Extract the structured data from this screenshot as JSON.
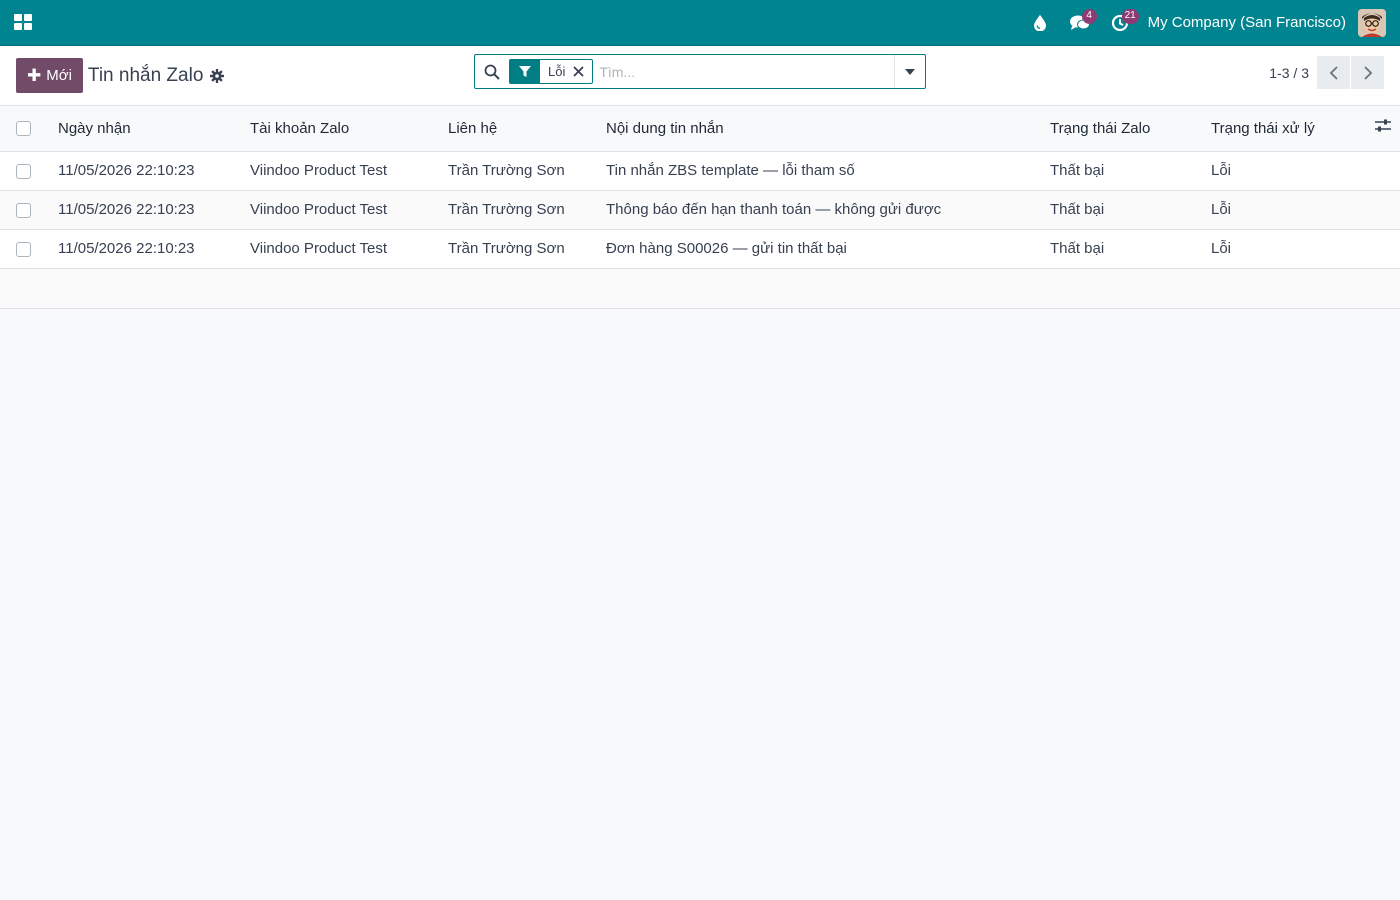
{
  "navbar": {
    "apps_icon": "apps-grid-icon",
    "icons": [
      {
        "name": "drop-icon",
        "badge": ""
      },
      {
        "name": "chat-icon",
        "badge": "4"
      },
      {
        "name": "activity-clock-icon",
        "badge": "21"
      }
    ],
    "company": "My Company (San Francisco)",
    "accent": "#00848f"
  },
  "control": {
    "new_label": "Mới",
    "title": "Tin nhắn Zalo",
    "search": {
      "facet_value": "Lỗi",
      "placeholder": "Tìm..."
    },
    "pager": "1-3 / 3"
  },
  "table": {
    "headers": [
      "Ngày nhận",
      "Tài khoản Zalo",
      "Liên hệ",
      "Nội dung tin nhắn",
      "Trạng thái Zalo",
      "Trạng thái xử lý"
    ],
    "rows": [
      [
        "11/05/2026 22:10:23",
        "Viindoo Product Test",
        "Trần Trường Sơn",
        "Tin nhắn ZBS template — lỗi tham số",
        "Thất bại",
        "Lỗi"
      ],
      [
        "11/05/2026 22:10:23",
        "Viindoo Product Test",
        "Trần Trường Sơn",
        "Thông báo đến hạn thanh toán — không gửi được",
        "Thất bại",
        "Lỗi"
      ],
      [
        "11/05/2026 22:10:23",
        "Viindoo Product Test",
        "Trần Trường Sơn",
        "Đơn hàng S00026 — gửi tin thất bại",
        "Thất bại",
        "Lỗi"
      ]
    ]
  },
  "colors": {
    "primary": "#714b67",
    "teal": "#017e84",
    "badge": "#8e3a73"
  }
}
